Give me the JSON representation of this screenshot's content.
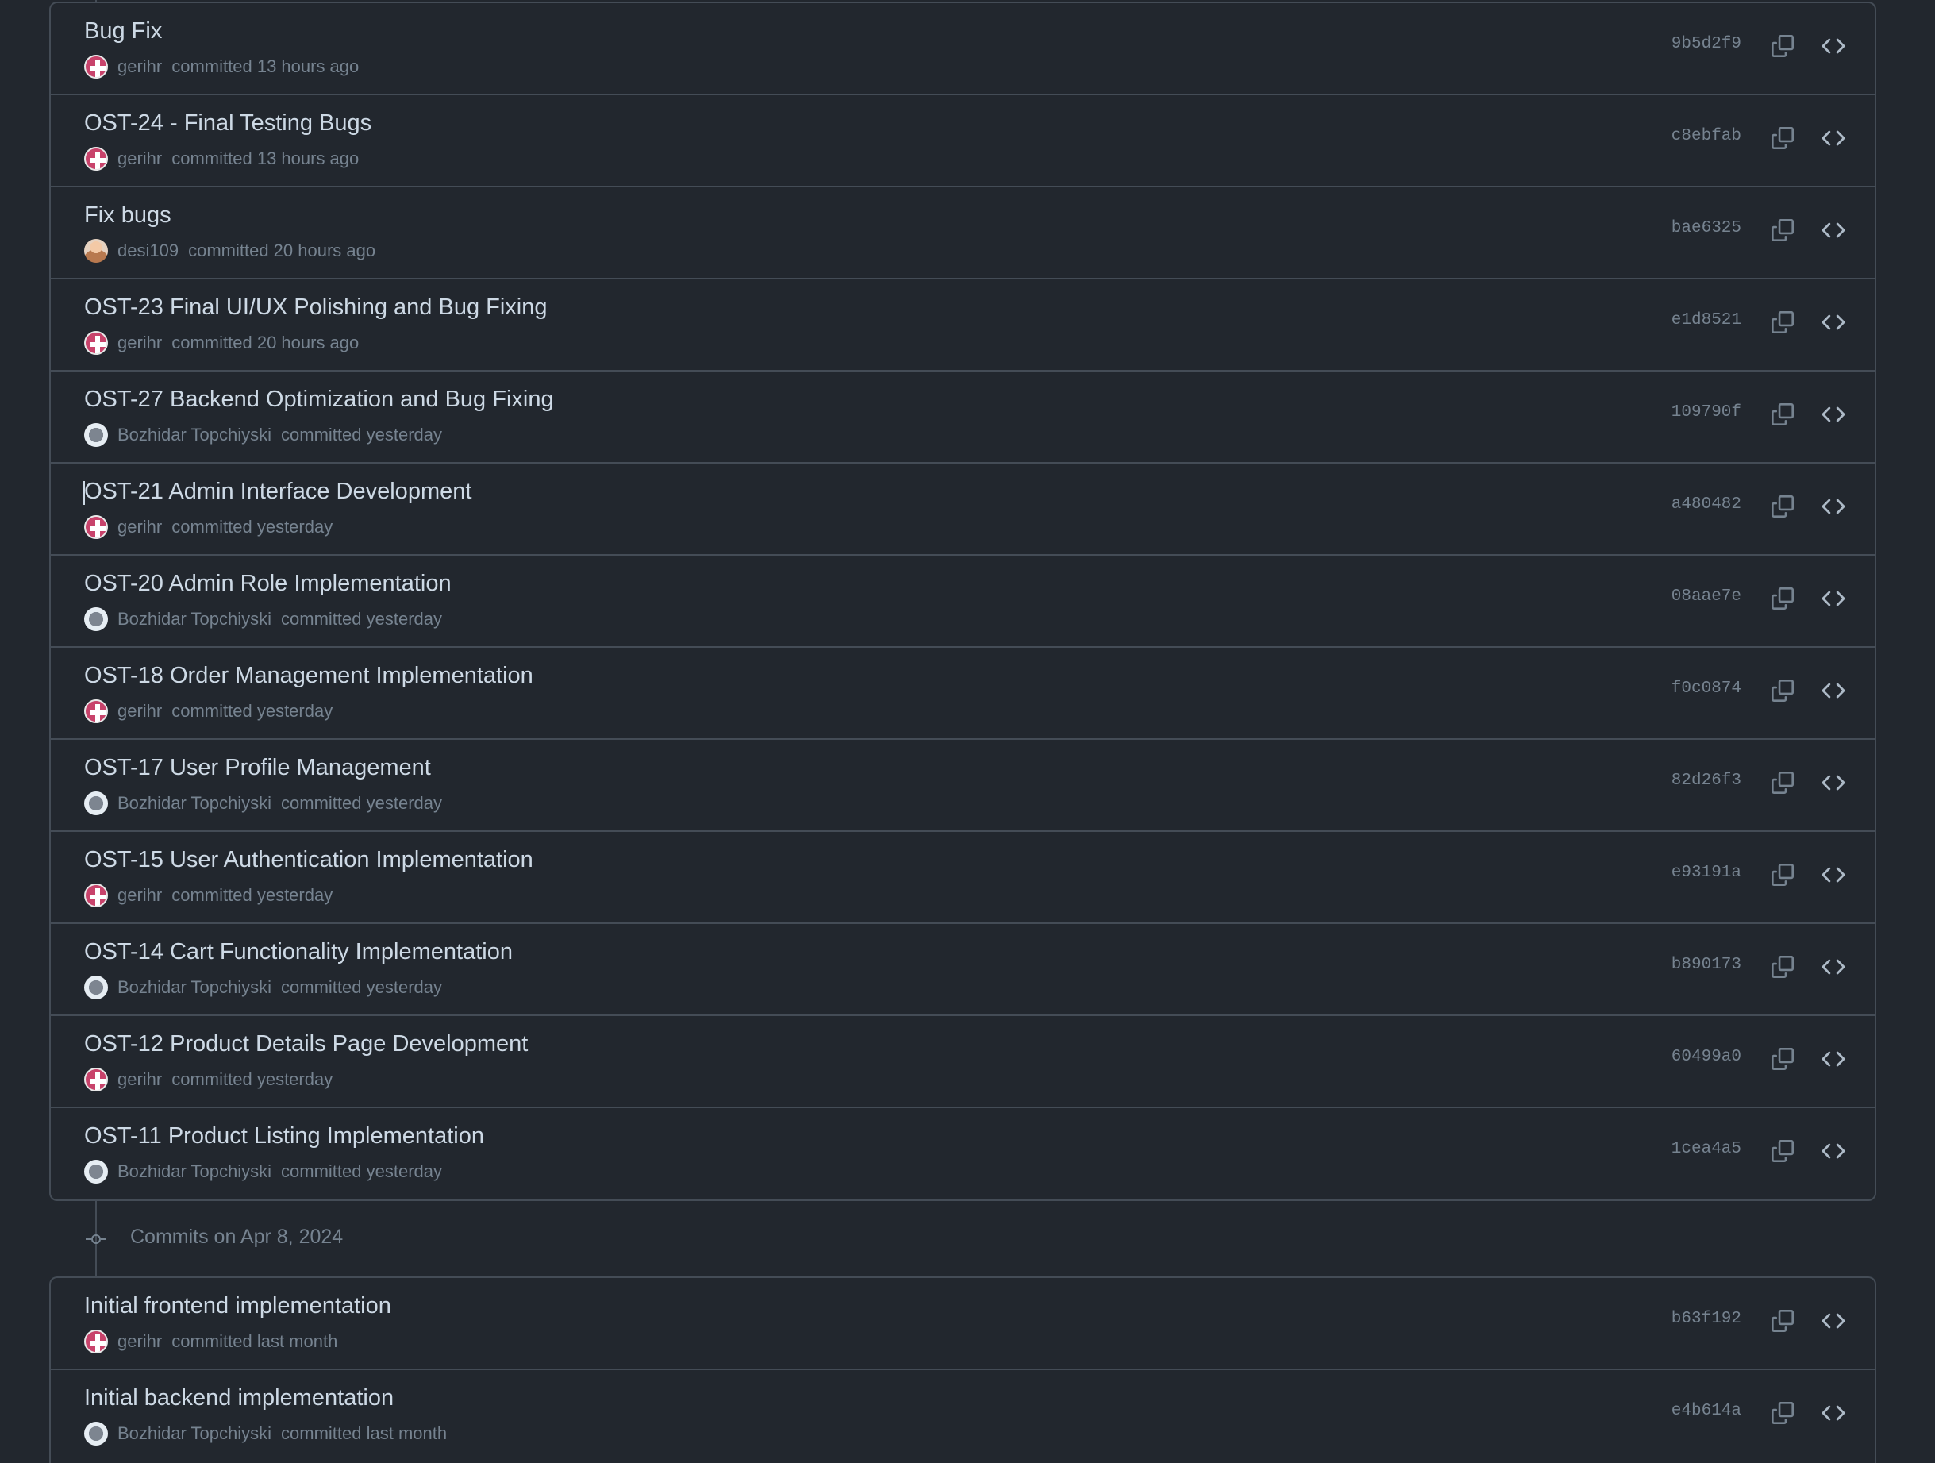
{
  "groups": [
    {
      "commits": [
        {
          "title": "Bug Fix",
          "author": "gerihr",
          "action": "committed",
          "time": "13 hours ago",
          "sha": "9b5d2f9",
          "avatar": "gerihr"
        },
        {
          "title": "OST-24 - Final Testing Bugs",
          "author": "gerihr",
          "action": "committed",
          "time": "13 hours ago",
          "sha": "c8ebfab",
          "avatar": "gerihr"
        },
        {
          "title": "Fix bugs",
          "author": "desi109",
          "action": "committed",
          "time": "20 hours ago",
          "sha": "bae6325",
          "avatar": "desi"
        },
        {
          "title": "OST-23 Final UI/UX Polishing and Bug Fixing",
          "author": "gerihr",
          "action": "committed",
          "time": "20 hours ago",
          "sha": "e1d8521",
          "avatar": "gerihr"
        },
        {
          "title": "OST-27 Backend Optimization and Bug Fixing",
          "author": "Bozhidar Topchiyski",
          "action": "committed",
          "time": "yesterday",
          "sha": "109790f",
          "avatar": "bozhidar"
        },
        {
          "title": "OST-21 Admin Interface Development",
          "author": "gerihr",
          "action": "committed",
          "time": "yesterday",
          "sha": "a480482",
          "avatar": "gerihr",
          "caret": true
        },
        {
          "title": "OST-20 Admin Role Implementation",
          "author": "Bozhidar Topchiyski",
          "action": "committed",
          "time": "yesterday",
          "sha": "08aae7e",
          "avatar": "bozhidar"
        },
        {
          "title": "OST-18 Order Management Implementation",
          "author": "gerihr",
          "action": "committed",
          "time": "yesterday",
          "sha": "f0c0874",
          "avatar": "gerihr"
        },
        {
          "title": "OST-17 User Profile Management",
          "author": "Bozhidar Topchiyski",
          "action": "committed",
          "time": "yesterday",
          "sha": "82d26f3",
          "avatar": "bozhidar"
        },
        {
          "title": "OST-15 User Authentication Implementation",
          "author": "gerihr",
          "action": "committed",
          "time": "yesterday",
          "sha": "e93191a",
          "avatar": "gerihr"
        },
        {
          "title": "OST-14 Cart Functionality Implementation",
          "author": "Bozhidar Topchiyski",
          "action": "committed",
          "time": "yesterday",
          "sha": "b890173",
          "avatar": "bozhidar"
        },
        {
          "title": "OST-12 Product Details Page Development",
          "author": "gerihr",
          "action": "committed",
          "time": "yesterday",
          "sha": "60499a0",
          "avatar": "gerihr"
        },
        {
          "title": "OST-11 Product Listing Implementation",
          "author": "Bozhidar Topchiyski",
          "action": "committed",
          "time": "yesterday",
          "sha": "1cea4a5",
          "avatar": "bozhidar"
        }
      ]
    },
    {
      "commits": [
        {
          "title": "Initial frontend implementation",
          "author": "gerihr",
          "action": "committed",
          "time": "last month",
          "sha": "b63f192",
          "avatar": "gerihr"
        },
        {
          "title": "Initial backend implementation",
          "author": "Bozhidar Topchiyski",
          "action": "committed",
          "time": "last month",
          "sha": "e4b614a",
          "avatar": "bozhidar"
        }
      ]
    }
  ],
  "separator": {
    "label": "Commits on Apr 8, 2024",
    "icon": "git-commit-icon"
  },
  "icons": {
    "copy": "copy-icon",
    "browse": "code-icon"
  },
  "colors": {
    "background": "#22272e",
    "border": "#444c56",
    "title": "#cdd9e5",
    "muted": "#768390"
  }
}
